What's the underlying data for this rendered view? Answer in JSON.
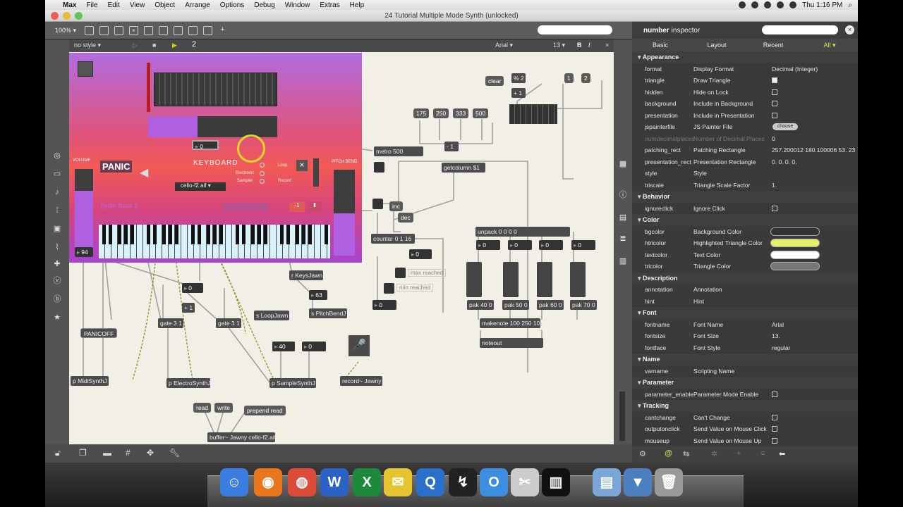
{
  "menubar": {
    "items": [
      "Max",
      "File",
      "Edit",
      "View",
      "Object",
      "Arrange",
      "Options",
      "Debug",
      "Window",
      "Extras",
      "Help"
    ],
    "clock": "Thu 1:16 PM"
  },
  "window": {
    "title": "24 Tutorial Multiple Mode Synth (unlocked)"
  },
  "toolbar": {
    "zoom": "100% ▾"
  },
  "format_bar": {
    "style": "no style ▾",
    "layer": "2",
    "font": "Arial ▾",
    "size": "13 ▾",
    "bold": "B",
    "italic": "I"
  },
  "patch": {
    "panic": "PANIC",
    "keyboard": "KEYBOARD",
    "volume": "VOLUME",
    "pitch_bend": "PITCH BEND",
    "sample": "cello-f2.aif",
    "preset": "Synth Bass 2",
    "number_box": "0",
    "volume_value": "94",
    "mode_labels": [
      "Electronic",
      "Sampler"
    ],
    "loop": "Loop",
    "record": "Record",
    "minus_one": "-1",
    "objects": {
      "clear": "clear",
      "mod2": "% 2",
      "plus1a": "+ 1",
      "one": "1",
      "two": "2",
      "n175": "175",
      "n250": "250",
      "n333": "333",
      "n500": "500",
      "metro": "metro 500",
      "neg1": "- 1",
      "getcolumn": "getcolumn $1",
      "inc": "inc",
      "dec": "dec",
      "counter": "counter 0 1 16",
      "zero_a": "0",
      "max_reached": "max reached",
      "min_reached": "min reached",
      "zero_b": "0",
      "unpack": "unpack 0 0 0 0",
      "u0": "0",
      "u1": "0",
      "u2": "0",
      "u3": "0",
      "pak40": "pak 40 0",
      "pak50": "pak 50 0",
      "pak60": "pak 60 0",
      "pak70": "pak 70 0",
      "makenote": "makenote 100 250 10",
      "noteout": "noteout",
      "keysjawn": "r KeysJawn",
      "n63": "63",
      "pitchbend": "s PitchBendJ",
      "zero_c": "0",
      "plus1b": "+ 1",
      "gate1": "gate 3 1",
      "gate2": "gate 3 1",
      "loopjawn": "s LoopJawn",
      "n40": "40",
      "zero_d": "0",
      "panicoff": "PANICOFF",
      "midisynth": "p MidiSynthJ",
      "electrosynth": "p ElectroSynthJ",
      "samplesynth": "p SampleSynthJ",
      "recordjawn": "record~ Jawny",
      "read": "read",
      "write": "write",
      "prepend": "prepend read",
      "buffer": "buffer~ Jawny cello-f2.aif"
    }
  },
  "inspector": {
    "title_bold": "number",
    "title_rest": "inspector",
    "tabs": [
      "Basic",
      "Layout",
      "Recent",
      "All ▾"
    ],
    "sections": [
      {
        "name": "Appearance",
        "rows": [
          {
            "key": "format",
            "label": "Display Format",
            "value": "Decimal (Integer)",
            "kind": "text"
          },
          {
            "key": "triangle",
            "label": "Draw Triangle",
            "value": "",
            "kind": "check-on"
          },
          {
            "key": "hidden",
            "label": "Hide on Lock",
            "value": "",
            "kind": "check"
          },
          {
            "key": "background",
            "label": "Include in Background",
            "value": "",
            "kind": "check"
          },
          {
            "key": "presentation",
            "label": "Include in Presentation",
            "value": "",
            "kind": "check"
          },
          {
            "key": "jspainterfile",
            "label": "JS Painter File",
            "value": "choose",
            "kind": "button"
          },
          {
            "key": "numdecimalplaces",
            "label": "Number of Decimal Places",
            "value": "0",
            "kind": "dim"
          },
          {
            "key": "patching_rect",
            "label": "Patching Rectangle",
            "value": "257.200012 180.100006 53. 23.",
            "kind": "text"
          },
          {
            "key": "presentation_rect",
            "label": "Presentation Rectangle",
            "value": "0. 0. 0. 0.",
            "kind": "text"
          },
          {
            "key": "style",
            "label": "Style",
            "value": "",
            "kind": "text"
          },
          {
            "key": "triscale",
            "label": "Triangle Scale Factor",
            "value": "1.",
            "kind": "text"
          }
        ]
      },
      {
        "name": "Behavior",
        "rows": [
          {
            "key": "ignoreclick",
            "label": "Ignore Click",
            "value": "",
            "kind": "check"
          }
        ]
      },
      {
        "name": "Color",
        "rows": [
          {
            "key": "bgcolor",
            "label": "Background Color",
            "value": "#333333",
            "kind": "swatch"
          },
          {
            "key": "htricolor",
            "label": "Highlighted Triangle Color",
            "value": "#e5f06a",
            "kind": "swatch"
          },
          {
            "key": "textcolor",
            "label": "Text Color",
            "value": "#ffffff",
            "kind": "swatch"
          },
          {
            "key": "tricolor",
            "label": "Triangle Color",
            "value": "#777777",
            "kind": "swatch"
          }
        ]
      },
      {
        "name": "Description",
        "rows": [
          {
            "key": "annotation",
            "label": "Annotation",
            "value": "",
            "kind": "text"
          },
          {
            "key": "hint",
            "label": "Hint",
            "value": "",
            "kind": "text"
          }
        ]
      },
      {
        "name": "Font",
        "rows": [
          {
            "key": "fontname",
            "label": "Font Name",
            "value": "Arial",
            "kind": "text"
          },
          {
            "key": "fontsize",
            "label": "Font Size",
            "value": "13.",
            "kind": "text"
          },
          {
            "key": "fontface",
            "label": "Font Style",
            "value": "regular",
            "kind": "text"
          }
        ]
      },
      {
        "name": "Name",
        "rows": [
          {
            "key": "varname",
            "label": "Scripting Name",
            "value": "",
            "kind": "text"
          }
        ]
      },
      {
        "name": "Parameter",
        "rows": [
          {
            "key": "parameter_enable",
            "label": "Parameter Mode Enable",
            "value": "",
            "kind": "check"
          }
        ]
      },
      {
        "name": "Tracking",
        "rows": [
          {
            "key": "cantchange",
            "label": "Can't Change",
            "value": "",
            "kind": "check"
          },
          {
            "key": "outputonclick",
            "label": "Send Value on Mouse Click",
            "value": "",
            "kind": "check"
          },
          {
            "key": "mouseup",
            "label": "Send Value on Mouse Up",
            "value": "",
            "kind": "check"
          }
        ]
      }
    ]
  },
  "dock": {
    "icons": [
      "finder-icon",
      "firefox-icon",
      "chrome-icon",
      "word-icon",
      "excel-icon",
      "mail-icon",
      "quicktime-icon",
      "max-icon",
      "o2-icon",
      "scissors-icon",
      "piano-icon",
      "folder-icon",
      "downloads-icon",
      "trash-icon"
    ],
    "colors": [
      "#3b7de0",
      "#e8761d",
      "#dd4b39",
      "#2b62c4",
      "#1d8a3b",
      "#e6c430",
      "#2a6fc9",
      "#222222",
      "#3b8ee0",
      "#cccccc",
      "#111111",
      "#7aa7d8",
      "#4c7fbf",
      "#999999"
    ]
  }
}
